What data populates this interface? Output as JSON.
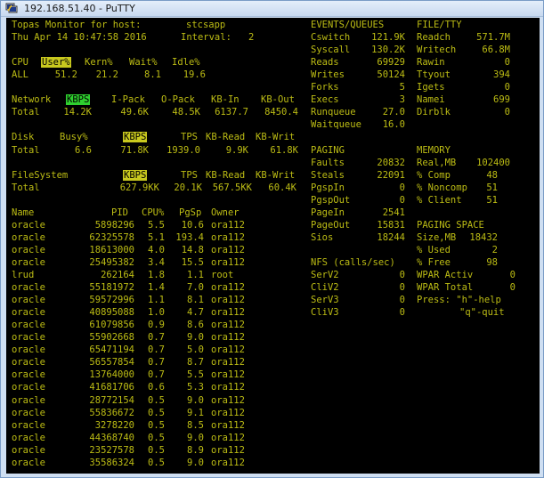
{
  "window": {
    "title": "192.168.51.40 - PuTTY",
    "icon": "putty-icon"
  },
  "header": {
    "line1_label": "Topas Monitor for host:",
    "host": "stcsapp",
    "date": "Thu Apr 14 10:47:58 2016",
    "interval_label": "Interval:",
    "interval": "2"
  },
  "cpu": {
    "label": "CPU",
    "headers": [
      "User%",
      "Kern%",
      "Wait%",
      "Idle%"
    ],
    "row_label": "ALL",
    "values": [
      "51.2",
      "21.2",
      "8.1",
      "19.6"
    ]
  },
  "network": {
    "label": "Network",
    "headers": [
      "KBPS",
      "I-Pack",
      "O-Pack",
      "KB-In",
      "KB-Out"
    ],
    "row_label": "Total",
    "values": [
      "14.2K",
      "49.6K",
      "48.5K",
      "6137.7",
      "8450.4"
    ]
  },
  "disk": {
    "label": "Disk",
    "headers": [
      "Busy%",
      "KBPS",
      "TPS",
      "KB-Read",
      "KB-Writ"
    ],
    "row_label": "Total",
    "values": [
      "6.6",
      "71.8K",
      "1939.0",
      "9.9K",
      "61.8K"
    ]
  },
  "filesystem": {
    "label": "FileSystem",
    "headers": [
      "KBPS",
      "TPS",
      "KB-Read",
      "KB-Writ"
    ],
    "row_label": "Total",
    "values": [
      "627.9KK",
      "20.1K",
      "567.5KK",
      "60.4K"
    ]
  },
  "processes": {
    "headers": [
      "Name",
      "PID",
      "CPU%",
      "PgSp",
      "Owner"
    ],
    "rows": [
      [
        "oracle",
        "5898296",
        "5.5",
        "10.6",
        "ora112"
      ],
      [
        "oracle",
        "62325578",
        "5.1",
        "193.4",
        "ora112"
      ],
      [
        "oracle",
        "18613000",
        "4.0",
        "14.8",
        "ora112"
      ],
      [
        "oracle",
        "25495382",
        "3.4",
        "15.5",
        "ora112"
      ],
      [
        "lrud",
        "262164",
        "1.8",
        "1.1",
        "root"
      ],
      [
        "oracle",
        "55181972",
        "1.4",
        "7.0",
        "ora112"
      ],
      [
        "oracle",
        "59572996",
        "1.1",
        "8.1",
        "ora112"
      ],
      [
        "oracle",
        "40895088",
        "1.0",
        "4.7",
        "ora112"
      ],
      [
        "oracle",
        "61079856",
        "0.9",
        "8.6",
        "ora112"
      ],
      [
        "oracle",
        "55902668",
        "0.7",
        "9.0",
        "ora112"
      ],
      [
        "oracle",
        "65471194",
        "0.7",
        "5.0",
        "ora112"
      ],
      [
        "oracle",
        "56557854",
        "0.7",
        "8.7",
        "ora112"
      ],
      [
        "oracle",
        "13764000",
        "0.7",
        "5.5",
        "ora112"
      ],
      [
        "oracle",
        "41681706",
        "0.6",
        "5.3",
        "ora112"
      ],
      [
        "oracle",
        "28772154",
        "0.5",
        "9.0",
        "ora112"
      ],
      [
        "oracle",
        "55836672",
        "0.5",
        "9.1",
        "ora112"
      ],
      [
        "oracle",
        "3278220",
        "0.5",
        "8.5",
        "ora112"
      ],
      [
        "oracle",
        "44368740",
        "0.5",
        "9.0",
        "ora112"
      ],
      [
        "oracle",
        "23527578",
        "0.5",
        "8.9",
        "ora112"
      ],
      [
        "oracle",
        "35586324",
        "0.5",
        "9.0",
        "ora112"
      ]
    ]
  },
  "events": {
    "title": "EVENTS/QUEUES",
    "rows": [
      [
        "Cswitch",
        "121.9K"
      ],
      [
        "Syscall",
        "130.2K"
      ],
      [
        "Reads",
        "69929"
      ],
      [
        "Writes",
        "50124"
      ],
      [
        "Forks",
        "5"
      ],
      [
        "Execs",
        "3"
      ],
      [
        "Runqueue",
        "27.0"
      ],
      [
        "Waitqueue",
        "16.0"
      ]
    ]
  },
  "filetty": {
    "title": "FILE/TTY",
    "rows": [
      [
        "Readch",
        "571.7M"
      ],
      [
        "Writech",
        "66.8M"
      ],
      [
        "Rawin",
        "0"
      ],
      [
        "Ttyout",
        "394"
      ],
      [
        "Igets",
        "0"
      ],
      [
        "Namei",
        "699"
      ],
      [
        "Dirblk",
        "0"
      ]
    ]
  },
  "paging": {
    "title": "PAGING",
    "rows": [
      [
        "Faults",
        "20832"
      ],
      [
        "Steals",
        "22091"
      ],
      [
        "PgspIn",
        "0"
      ],
      [
        "PgspOut",
        "0"
      ],
      [
        "PageIn",
        "2541"
      ],
      [
        "PageOut",
        "15831"
      ],
      [
        "Sios",
        "18244"
      ]
    ]
  },
  "memory": {
    "title": "MEMORY",
    "rows": [
      [
        "Real,MB",
        "102400"
      ],
      [
        "% Comp",
        "48"
      ],
      [
        "% Noncomp",
        "51"
      ],
      [
        "% Client",
        "51"
      ]
    ]
  },
  "paging_space": {
    "title": "PAGING SPACE",
    "rows": [
      [
        "Size,MB",
        "18432"
      ],
      [
        "% Used",
        "2"
      ],
      [
        "% Free",
        "98"
      ]
    ]
  },
  "nfs": {
    "title": "NFS (calls/sec)",
    "rows": [
      [
        "SerV2",
        "0"
      ],
      [
        "CliV2",
        "0"
      ],
      [
        "SerV3",
        "0"
      ],
      [
        "CliV3",
        "0"
      ]
    ]
  },
  "wpar": {
    "rows": [
      [
        "WPAR Activ",
        "0"
      ],
      [
        "WPAR Total",
        "0"
      ]
    ]
  },
  "help": {
    "line1": "Press: \"h\"-help",
    "line2": "\"q\"-quit"
  },
  "colors": {
    "text": "#bcbc14",
    "highlight": "#c8c81e",
    "highlight_green": "#2fd02f",
    "background": "#000000"
  }
}
